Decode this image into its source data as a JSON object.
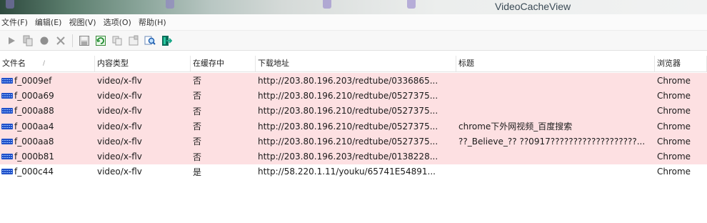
{
  "window": {
    "title": "VideoCacheView"
  },
  "menu": [
    "文件(F)",
    "编辑(E)",
    "视图(V)",
    "选项(O)",
    "帮助(H)"
  ],
  "toolbar": [
    {
      "icon": "play-icon"
    },
    {
      "icon": "copy-files-icon"
    },
    {
      "icon": "record-icon"
    },
    {
      "icon": "delete-icon"
    },
    {
      "icon": "save-icon"
    },
    {
      "icon": "refresh-icon"
    },
    {
      "icon": "copy-icon"
    },
    {
      "icon": "properties-icon"
    },
    {
      "icon": "find-icon"
    },
    {
      "icon": "exit-icon"
    }
  ],
  "columns": [
    "文件名",
    "内容类型",
    "在缓存中",
    "下载地址",
    "标题",
    "浏览器"
  ],
  "sort_indicator": "/",
  "rows": [
    {
      "name": "f_0009ef",
      "type": "video/x-flv",
      "cached": "否",
      "url": "http://203.80.196.203/redtube/0336865...",
      "title": "",
      "browser": "Chrome",
      "highlight": true
    },
    {
      "name": "f_000a69",
      "type": "video/x-flv",
      "cached": "否",
      "url": "http://203.80.196.210/redtube/0527375...",
      "title": "",
      "browser": "Chrome",
      "highlight": true
    },
    {
      "name": "f_000a88",
      "type": "video/x-flv",
      "cached": "否",
      "url": "http://203.80.196.210/redtube/0527375...",
      "title": "",
      "browser": "Chrome",
      "highlight": true
    },
    {
      "name": "f_000aa4",
      "type": "video/x-flv",
      "cached": "否",
      "url": "http://203.80.196.210/redtube/0527375...",
      "title": "chrome下外网视频_百度搜索",
      "browser": "Chrome",
      "highlight": true
    },
    {
      "name": "f_000aa8",
      "type": "video/x-flv",
      "cached": "否",
      "url": "http://203.80.196.210/redtube/0527375...",
      "title": "??_Believe_?? ??0917???????????????????...",
      "browser": "Chrome",
      "highlight": true
    },
    {
      "name": "f_000b81",
      "type": "video/x-flv",
      "cached": "否",
      "url": "http://203.80.196.203/redtube/0138228...",
      "title": "",
      "browser": "Chrome",
      "highlight": true
    },
    {
      "name": "f_000c44",
      "type": "video/x-flv",
      "cached": "是",
      "url": "http://58.220.1.11/youku/65741E54891...",
      "title": "",
      "browser": "Chrome",
      "highlight": false
    }
  ],
  "colors": {
    "highlight_row": "#fde0e2",
    "file_icon": "#1e4fc9"
  }
}
